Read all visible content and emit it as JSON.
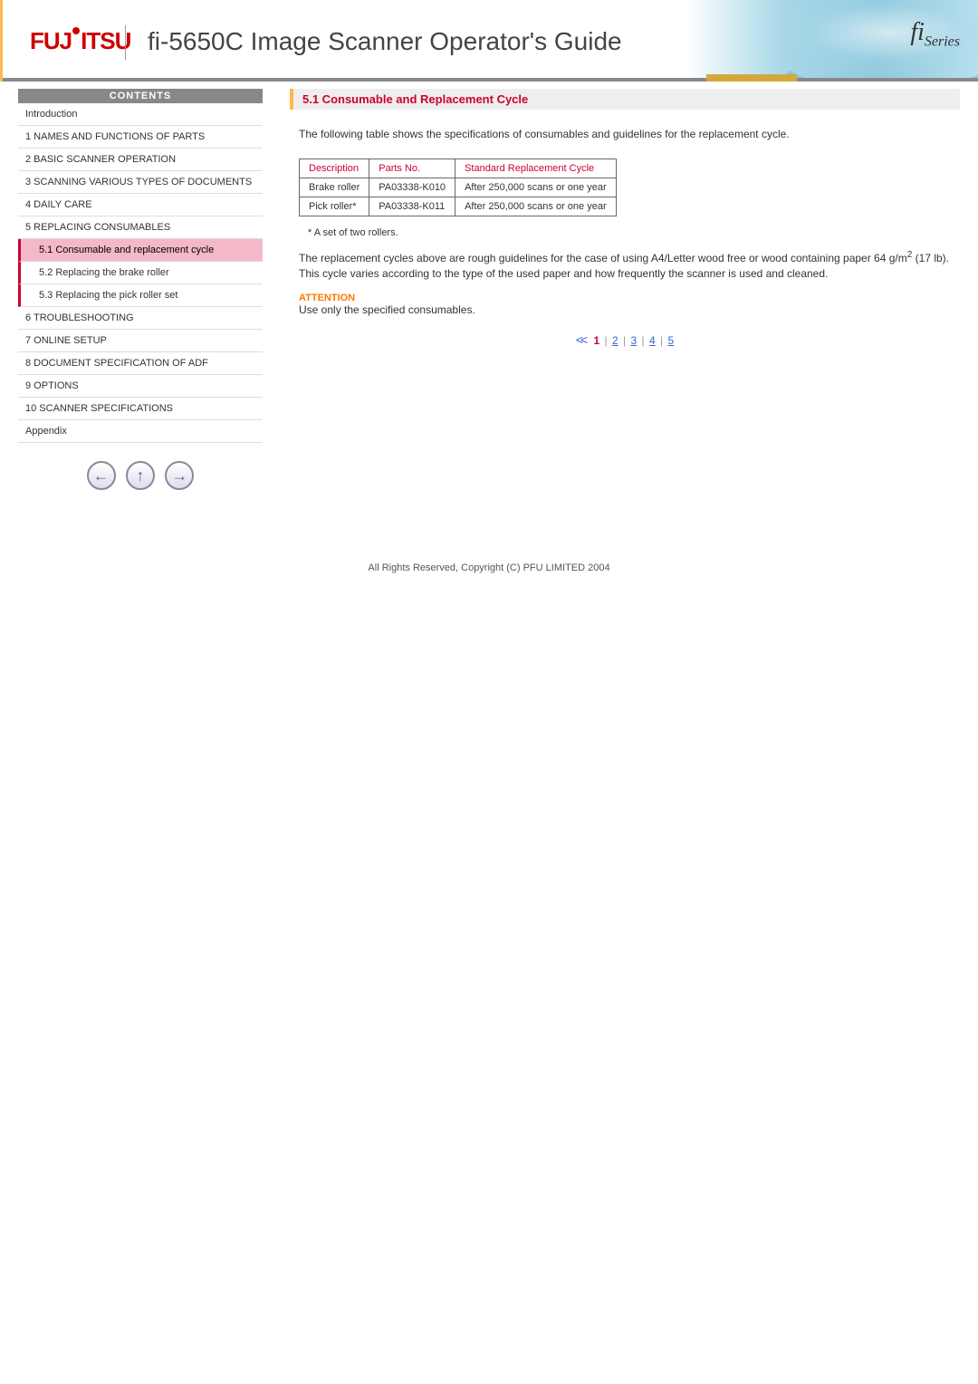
{
  "header": {
    "brand": "FUJITSU",
    "title": "fi-5650C Image Scanner Operator's Guide",
    "badge_prefix": "fi",
    "badge_suffix": "Series"
  },
  "sidebar": {
    "header": "CONTENTS",
    "items": [
      "Introduction",
      "1 NAMES AND FUNCTIONS OF PARTS",
      "2 BASIC SCANNER OPERATION",
      "3 SCANNING VARIOUS TYPES OF DOCUMENTS",
      "4 DAILY CARE",
      "5 REPLACING CONSUMABLES"
    ],
    "subs": [
      "5.1 Consumable and replacement cycle",
      "5.2 Replacing the brake roller",
      "5.3 Replacing the pick roller set"
    ],
    "items2": [
      "6 TROUBLESHOOTING",
      "7 ONLINE SETUP",
      "8 DOCUMENT SPECIFICATION OF ADF",
      "9 OPTIONS",
      "10 SCANNER SPECIFICATIONS",
      "Appendix"
    ]
  },
  "main": {
    "section_title": "5.1 Consumable and Replacement Cycle",
    "intro": "The following table shows the specifications of consumables and guidelines for the replacement cycle.",
    "table": {
      "headers": [
        "Description",
        "Parts No.",
        "Standard Replacement Cycle"
      ],
      "rows": [
        [
          "Brake roller",
          "PA03338-K010",
          "After 250,000 scans or one year"
        ],
        [
          "Pick roller*",
          "PA03338-K011",
          "After 250,000 scans or one year"
        ]
      ]
    },
    "footnote": "* A set of two rollers.",
    "para_before": "The replacement cycles above are rough guidelines for the case of using A4/Letter wood free or wood containing paper 64 g/m",
    "para_sup": "2",
    "para_after": " (17 lb). This cycle varies according to the type of the used paper and how frequently the scanner is used and cleaned.",
    "attention_label": "ATTENTION",
    "attention_text": "Use only the specified consumables.",
    "pager": {
      "prev_symbol": "<<",
      "current": "1",
      "links": [
        "2",
        "3",
        "4",
        "5"
      ]
    }
  },
  "footer": "All Rights Reserved, Copyright (C) PFU LIMITED 2004"
}
